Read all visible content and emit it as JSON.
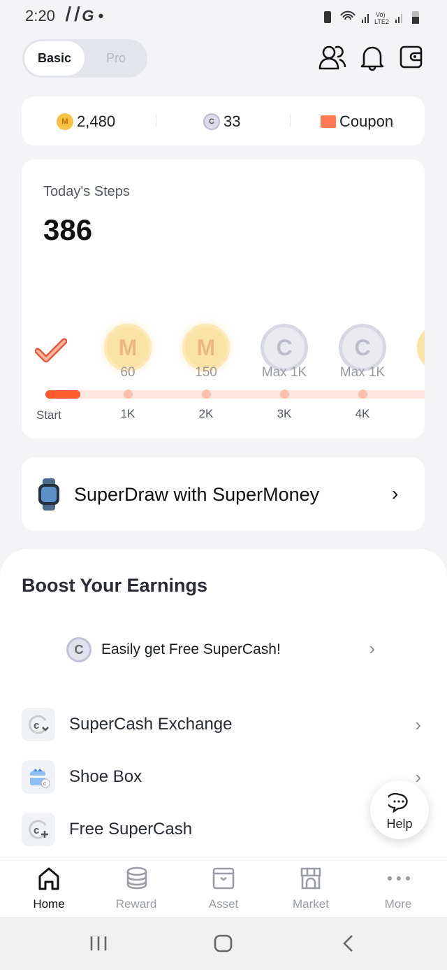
{
  "status_bar": {
    "time": "2:20",
    "left_icons": [
      "s-icon",
      "s-icon",
      "google-icon",
      "dot-icon"
    ],
    "right_icons": [
      "battery-saver-icon",
      "wifi-icon",
      "signal-icon",
      "volte-icon",
      "signal-icon",
      "battery-icon"
    ],
    "volte": "Vo) LTE2"
  },
  "header": {
    "toggle": [
      "Basic",
      "Pro"
    ],
    "selected": "Basic",
    "icons": [
      "friends-icon",
      "bell-icon",
      "wallet-icon"
    ]
  },
  "balances": {
    "supermoney": "2,480",
    "supercash": "33",
    "coupon": "Coupon",
    "coin_m": "M",
    "coin_c": "C"
  },
  "steps": {
    "title": "Today's Steps",
    "count": "386",
    "progress_fraction": 0.04,
    "milestones": [
      {
        "coin": "M",
        "reward": "60",
        "tick": "1K"
      },
      {
        "coin": "M",
        "reward": "150",
        "tick": "2K"
      },
      {
        "coin": "C",
        "reward": "Max 1K",
        "tick": "3K"
      },
      {
        "coin": "C",
        "reward": "Max 1K",
        "tick": "4K"
      }
    ],
    "start_label": "Start"
  },
  "superdraw": {
    "label": "SuperDraw with SuperMoney"
  },
  "boost": {
    "title": "Boost Your Earnings",
    "promo": "Easily get Free SuperCash!",
    "items": [
      {
        "label": "SuperCash Exchange"
      },
      {
        "label": "Shoe Box"
      },
      {
        "label": "Free SuperCash"
      }
    ]
  },
  "help": {
    "label": "Help"
  },
  "tabs": [
    {
      "label": "Home",
      "active": true
    },
    {
      "label": "Reward"
    },
    {
      "label": "Asset"
    },
    {
      "label": "Market"
    },
    {
      "label": "More"
    }
  ],
  "colors": {
    "accent": "#ff5a2e",
    "gold": "#f6c244",
    "text": "#1b1b22"
  }
}
